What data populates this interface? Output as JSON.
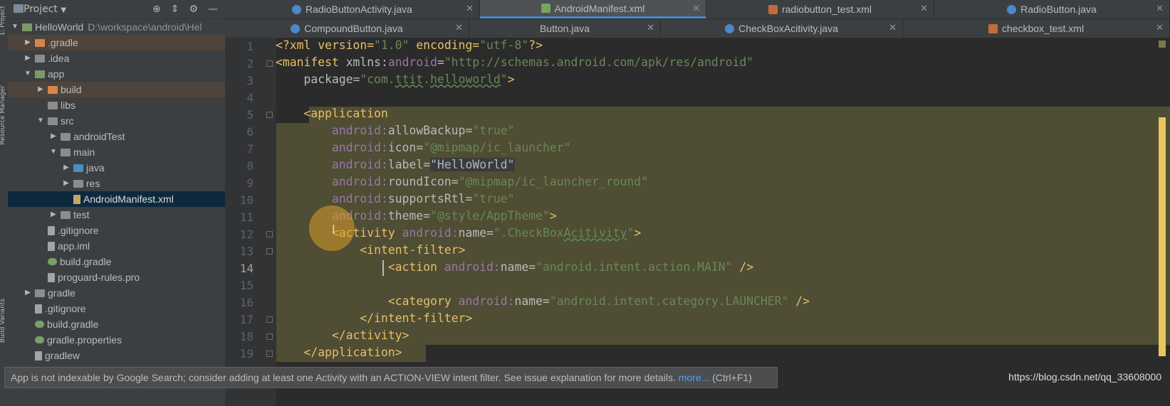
{
  "toolstrip": {
    "project_label": "1: Project",
    "resource_label": "Resource Manager",
    "build_variants_label": "Build Variants"
  },
  "project_panel": {
    "title": "Project",
    "tree": [
      {
        "label": "HelloWorld",
        "path": "D:\\workspace\\android\\Hel"
      },
      {
        "label": ".gradle"
      },
      {
        "label": ".idea"
      },
      {
        "label": "app"
      },
      {
        "label": "build"
      },
      {
        "label": "libs"
      },
      {
        "label": "src"
      },
      {
        "label": "androidTest"
      },
      {
        "label": "main"
      },
      {
        "label": "java"
      },
      {
        "label": "res"
      },
      {
        "label": "AndroidManifest.xml"
      },
      {
        "label": "test"
      },
      {
        "label": ".gitignore"
      },
      {
        "label": "app.iml"
      },
      {
        "label": "build.gradle"
      },
      {
        "label": "proguard-rules.pro"
      },
      {
        "label": "gradle"
      },
      {
        "label": ".gitignore"
      },
      {
        "label": "build.gradle"
      },
      {
        "label": "gradle.properties"
      },
      {
        "label": "gradlew"
      }
    ]
  },
  "tabs": {
    "row1": [
      "RadioButtonActivity.java",
      "AndroidManifest.xml",
      "radiobutton_test.xml",
      "RadioButton.java"
    ],
    "row2": [
      "CompoundButton.java",
      "Button.java",
      "CheckBoxAcitivity.java",
      "checkbox_test.xml"
    ]
  },
  "editor": {
    "line_numbers": [
      "1",
      "2",
      "3",
      "4",
      "5",
      "6",
      "7",
      "8",
      "9",
      "10",
      "11",
      "12",
      "13",
      "14",
      "15",
      "16",
      "17",
      "18",
      "19"
    ],
    "current_line": "14",
    "code": {
      "l1_a": "<?xml version=",
      "l1_b": "\"1.0\"",
      "l1_c": " encoding=",
      "l1_d": "\"utf-8\"",
      "l1_e": "?>",
      "l2_tag": "<manifest ",
      "l2_ns": "xmlns:",
      "l2_attr": "android",
      "l2_eq": "=",
      "l2_val": "\"http://schemas.android.com/apk/res/android\"",
      "l3_attr": "package",
      "l3_val1": "\"com.",
      "l3_val2": "ttit",
      "l3_val3": ".",
      "l3_val4": "helloworld",
      "l3_val5": "\"",
      "l3_end": ">",
      "l5_tag": "<application",
      "ns": "android:",
      "l6_attr": "allowBackup",
      "l6_val": "\"true\"",
      "l7_attr": "icon",
      "l7_val": "\"@mipmap/ic_launcher\"",
      "l8_attr": "label",
      "l8_val": "\"HelloWorld\"",
      "l9_attr": "roundIcon",
      "l9_val": "\"@mipmap/ic_launcher_round\"",
      "l10_attr": "supportsRtl",
      "l10_val": "\"true\"",
      "l11_attr": "theme",
      "l11_val": "\"@style/AppTheme\"",
      "l11_end": ">",
      "l12_tag": "<activity ",
      "l12_attr": "name",
      "l12_val1": "\".CheckBox",
      "l12_val2": "Acitivity",
      "l12_val3": "\"",
      "l12_end": ">",
      "l13_tag": "<intent-filter>",
      "l14_tag": "<action ",
      "l14_attr": "name",
      "l14_val": "\"android.intent.action.MAIN\"",
      "l14_end": " />",
      "l16_tag": "<category ",
      "l16_attr": "name",
      "l16_val": "\"android.intent.category.LAUNCHER\"",
      "l16_end": " />",
      "l17_tag": "</intent-filter>",
      "l18_tag": "</activity>",
      "l19_tag": "</application>",
      "eq": "="
    }
  },
  "status": {
    "message": "App is not indexable by Google Search; consider adding at least one Activity with an ACTION-VIEW intent filter. See issue explanation for more details. ",
    "more": "more...",
    "shortcut": " (Ctrl+F1)"
  },
  "watermark": "https://blog.csdn.net/qq_33608000",
  "colors": {
    "background": "#2b2b2b",
    "panel": "#3c3f41",
    "selection": "#4f4d33",
    "tag": "#e8bf6a",
    "string": "#6a8759",
    "namespace": "#9876aa",
    "accent": "#4a88c7"
  }
}
